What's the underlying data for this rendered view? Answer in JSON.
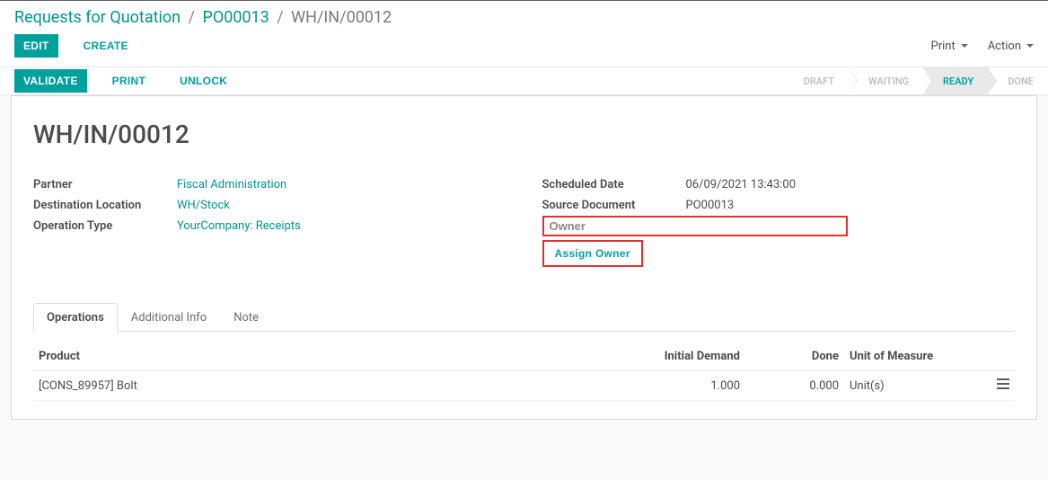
{
  "breadcrumb": {
    "root": "Requests for Quotation",
    "po": "PO00013",
    "current": "WH/IN/00012"
  },
  "buttons": {
    "edit": "EDIT",
    "create": "CREATE",
    "validate": "VALIDATE",
    "print": "PRINT",
    "unlock": "UNLOCK",
    "print_menu": "Print",
    "action_menu": "Action",
    "assign_owner": "Assign Owner"
  },
  "status": {
    "draft": "DRAFT",
    "waiting": "WAITING",
    "ready": "READY",
    "done": "DONE"
  },
  "doc": {
    "title": "WH/IN/00012",
    "left": {
      "partner_label": "Partner",
      "partner_value": "Fiscal Administration",
      "dest_label": "Destination Location",
      "dest_value": "WH/Stock",
      "op_label": "Operation Type",
      "op_value": "YourCompany: Receipts"
    },
    "right": {
      "sched_label": "Scheduled Date",
      "sched_value": "06/09/2021 13:43:00",
      "src_label": "Source Document",
      "src_value": "PO00013",
      "owner_placeholder": "Owner"
    }
  },
  "tabs": {
    "operations": "Operations",
    "additional": "Additional Info",
    "note": "Note"
  },
  "table": {
    "headers": {
      "product": "Product",
      "initial_demand": "Initial Demand",
      "done": "Done",
      "uom": "Unit of Measure"
    },
    "rows": [
      {
        "product": "[CONS_89957] Bolt",
        "initial_demand": "1.000",
        "done": "0.000",
        "uom": "Unit(s)"
      }
    ]
  }
}
